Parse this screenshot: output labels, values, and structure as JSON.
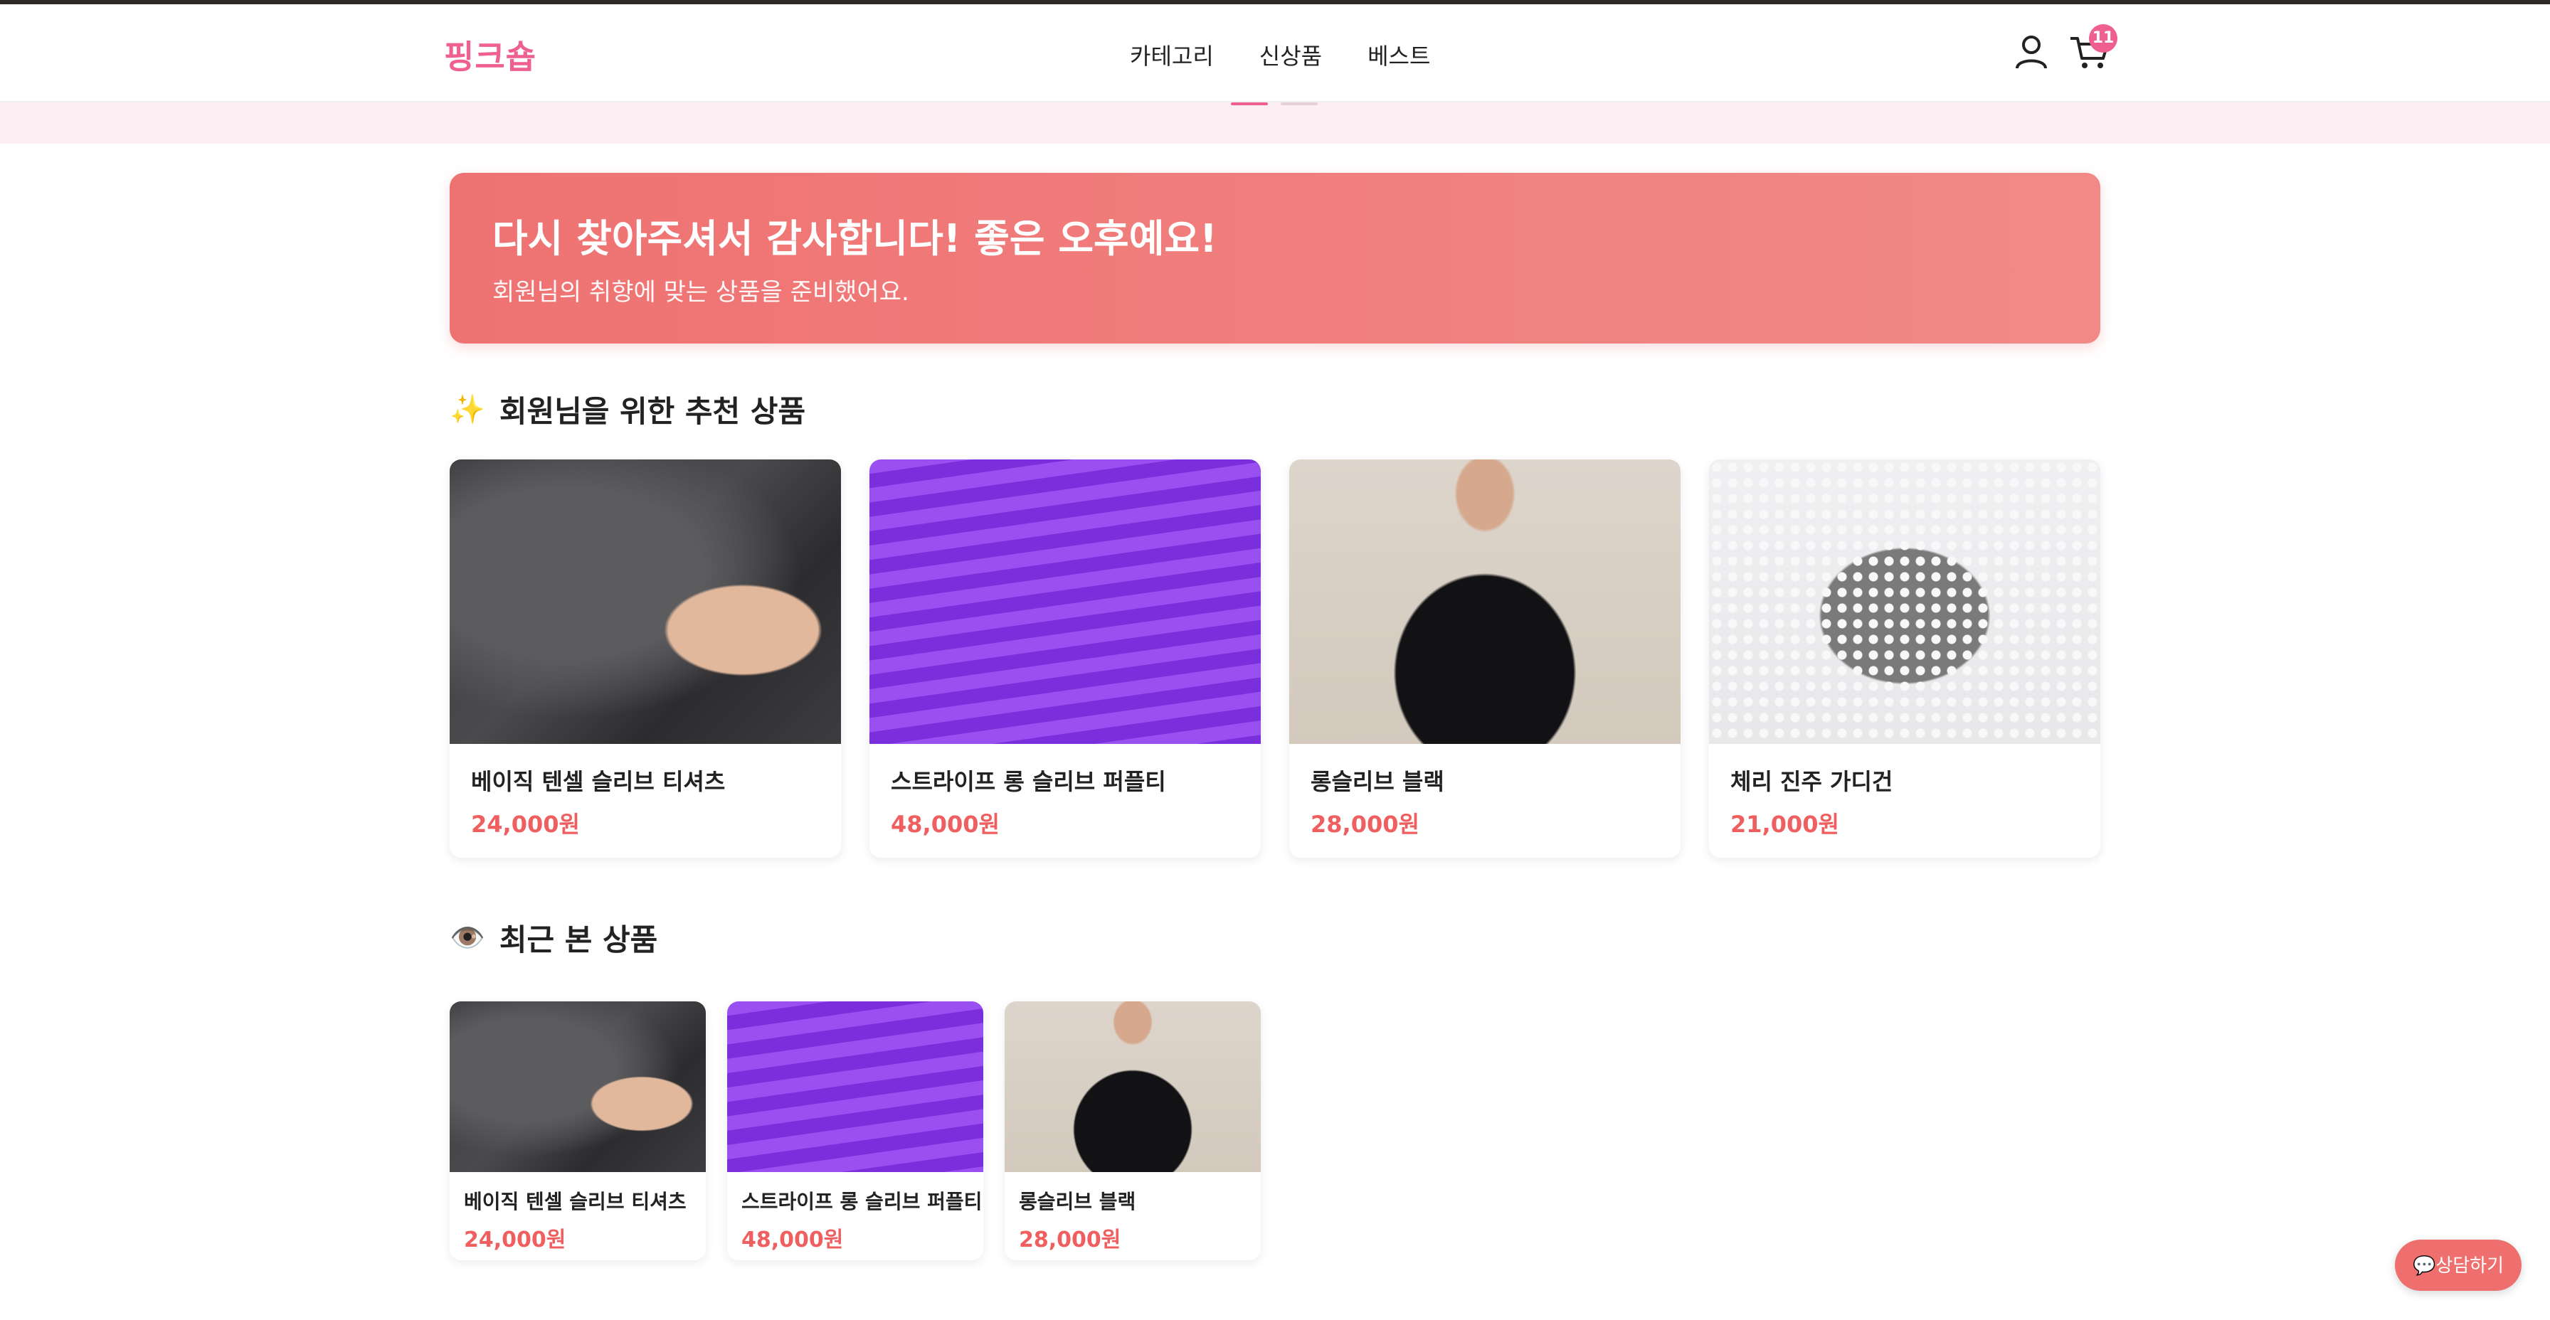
{
  "header": {
    "logo": "핑크숍",
    "nav": [
      "카테고리",
      "신상품",
      "베스트"
    ],
    "cart_count": "11",
    "icons": {
      "user": "user-icon",
      "cart": "cart-icon"
    }
  },
  "banner": {
    "title": "다시 찾아주셔서 감사합니다! 좋은 오후예요!",
    "subtitle": "회원님의 취향에 맞는 상품을 준비했어요."
  },
  "recommended": {
    "icon": "✨",
    "title": "회원님을 위한 추천 상품",
    "items": [
      {
        "name": "베이직 텐셀 슬리브 티셔츠",
        "price": "24,000원"
      },
      {
        "name": "스트라이프 롱 슬리브 퍼플티",
        "price": "48,000원"
      },
      {
        "name": "롱슬리브 블랙",
        "price": "28,000원"
      },
      {
        "name": "체리 진주 가디건",
        "price": "21,000원"
      }
    ]
  },
  "recent": {
    "icon": "👁️",
    "title": "최근 본 상품",
    "items": [
      {
        "name": "베이직 텐셀 슬리브 티셔츠",
        "price": "24,000원"
      },
      {
        "name": "스트라이프 롱 슬리브 퍼플티",
        "price": "48,000원"
      },
      {
        "name": "롱슬리브 블랙",
        "price": "28,000원"
      }
    ]
  },
  "chat_button": {
    "label": "💬상담하기"
  },
  "colors": {
    "brand": "#ef5f8f",
    "price": "#ef5f5f",
    "banner": "#ef7272"
  }
}
